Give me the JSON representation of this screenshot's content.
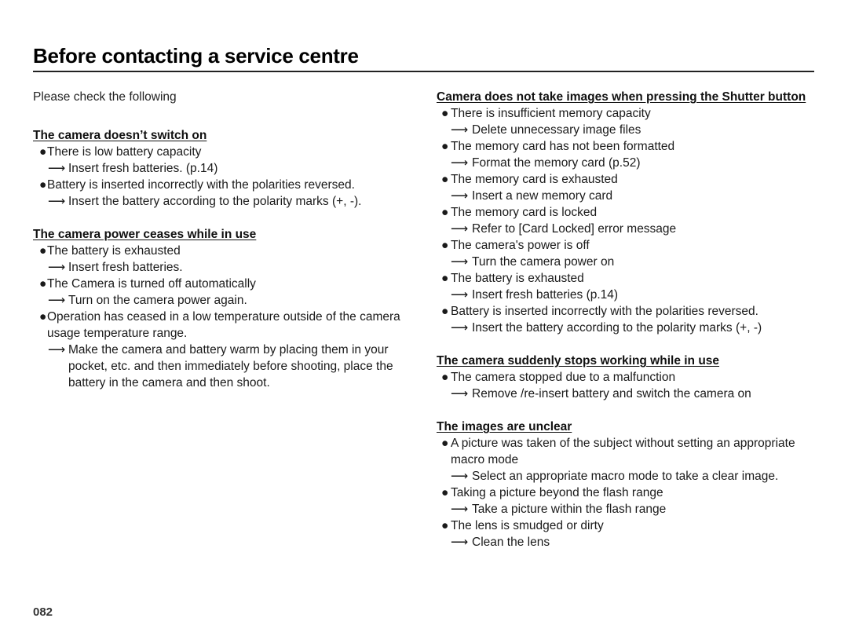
{
  "page": {
    "title": "Before contacting a service centre",
    "page_number": "082"
  },
  "left": {
    "intro": "Please check the following",
    "sections": [
      {
        "heading": "The camera doesn’t switch on",
        "items": [
          {
            "cause": "There is low battery capacity",
            "remedy": " Insert fresh batteries. (p.14)"
          },
          {
            "cause": "Battery is inserted incorrectly with the polarities reversed.",
            "remedy": "Insert the battery according to the polarity marks (+, -)."
          }
        ]
      },
      {
        "heading": "The camera power ceases while in use",
        "items": [
          {
            "cause": "The battery is exhausted",
            "remedy": "Insert fresh batteries."
          },
          {
            "cause": "The Camera is turned off automatically",
            "remedy": "Turn on the camera power again."
          },
          {
            "cause": "Operation has ceased in a low temperature outside of the camera usage temperature range.",
            "remedy": "Make the camera and battery warm by placing them in your pocket, etc. and then immediately before shooting, place the battery in the camera and then shoot."
          }
        ]
      }
    ]
  },
  "right": {
    "sections": [
      {
        "heading": "Camera does not take images when pressing the Shutter button",
        "items": [
          {
            "cause": "There is insufficient memory capacity",
            "remedy": "Delete unnecessary image files"
          },
          {
            "cause": "The memory card has not been formatted",
            "remedy": "Format the memory card (p.52)"
          },
          {
            "cause": "The memory card is exhausted",
            "remedy": "Insert a new memory card"
          },
          {
            "cause": "The memory card is locked",
            "remedy": "Refer to [Card Locked] error message"
          },
          {
            "cause": "The camera's power is off",
            "remedy": "Turn the camera power on"
          },
          {
            "cause": "The battery is exhausted",
            "remedy": "Insert fresh batteries (p.14)"
          },
          {
            "cause": "Battery is inserted incorrectly with the polarities reversed.",
            "remedy": "Insert the battery according to the polarity marks (+, -)"
          }
        ]
      },
      {
        "heading": "The camera suddenly stops working while in use",
        "items": [
          {
            "cause": "The camera stopped due to a malfunction",
            "remedy": "Remove /re-insert battery and switch the camera on"
          }
        ]
      },
      {
        "heading": "The images are unclear",
        "items": [
          {
            "cause": "A picture was taken of the subject without setting an appropriate macro mode",
            "remedy": "Select an appropriate macro mode to take a clear image."
          },
          {
            "cause": "Taking a picture beyond the flash range",
            "remedy": "Take a picture within the flash range"
          },
          {
            "cause": "The lens is smudged or dirty",
            "remedy": "Clean the lens"
          }
        ]
      }
    ]
  },
  "glyphs": {
    "bullet": "●",
    "arrow": "⟶"
  }
}
